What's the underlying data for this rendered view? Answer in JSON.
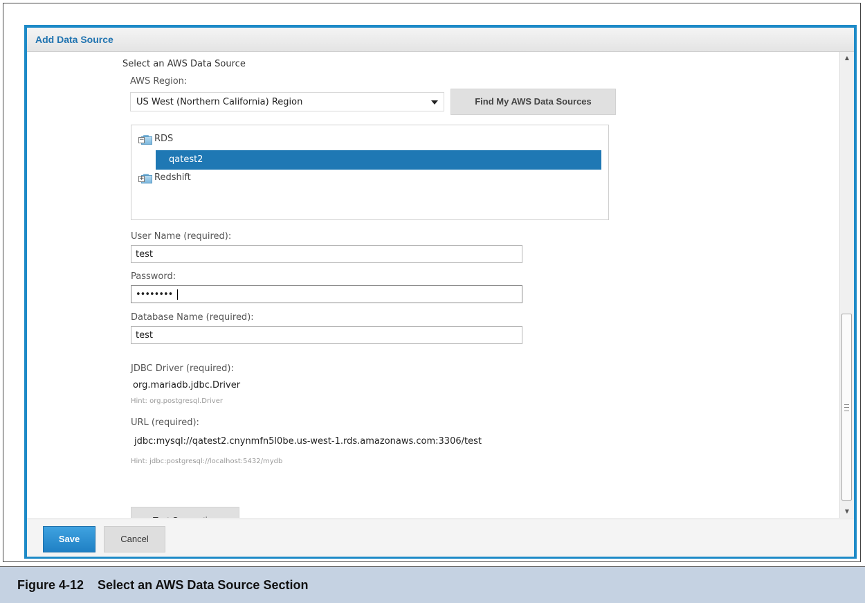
{
  "dialog": {
    "title": "Add Data Source"
  },
  "form": {
    "section_title": "Select an AWS Data Source",
    "region": {
      "label": "AWS Region:",
      "value": "US West (Northern California) Region"
    },
    "find_button_label": "Find My AWS Data Sources",
    "tree": {
      "nodes": [
        {
          "label": "RDS",
          "expanded": true,
          "children": [
            "qatest2"
          ]
        },
        {
          "label": "Redshift",
          "expanded": false
        }
      ],
      "selected": "qatest2"
    },
    "username": {
      "label": "User Name (required):",
      "value": "test"
    },
    "password": {
      "label": "Password:",
      "value": "••••••••"
    },
    "database": {
      "label": "Database Name (required):",
      "value": "test"
    },
    "jdbc_driver": {
      "label": "JDBC Driver (required):",
      "value": "org.mariadb.jdbc.Driver",
      "hint": "Hint: org.postgresql.Driver"
    },
    "url": {
      "label": "URL (required):",
      "value": "jdbc:mysql://qatest2.cnynmfn5l0be.us-west-1.rds.amazonaws.com:3306/test",
      "hint": "Hint: jdbc:postgresql://localhost:5432/mydb"
    },
    "test_button_label": "Test Connection"
  },
  "footer": {
    "save_label": "Save",
    "cancel_label": "Cancel"
  },
  "caption": "Figure 4-12    Select an AWS Data Source Section",
  "colors": {
    "accent": "#1d8ac7",
    "selection": "#1f78b4",
    "caption_bg": "#c5d2e2"
  }
}
